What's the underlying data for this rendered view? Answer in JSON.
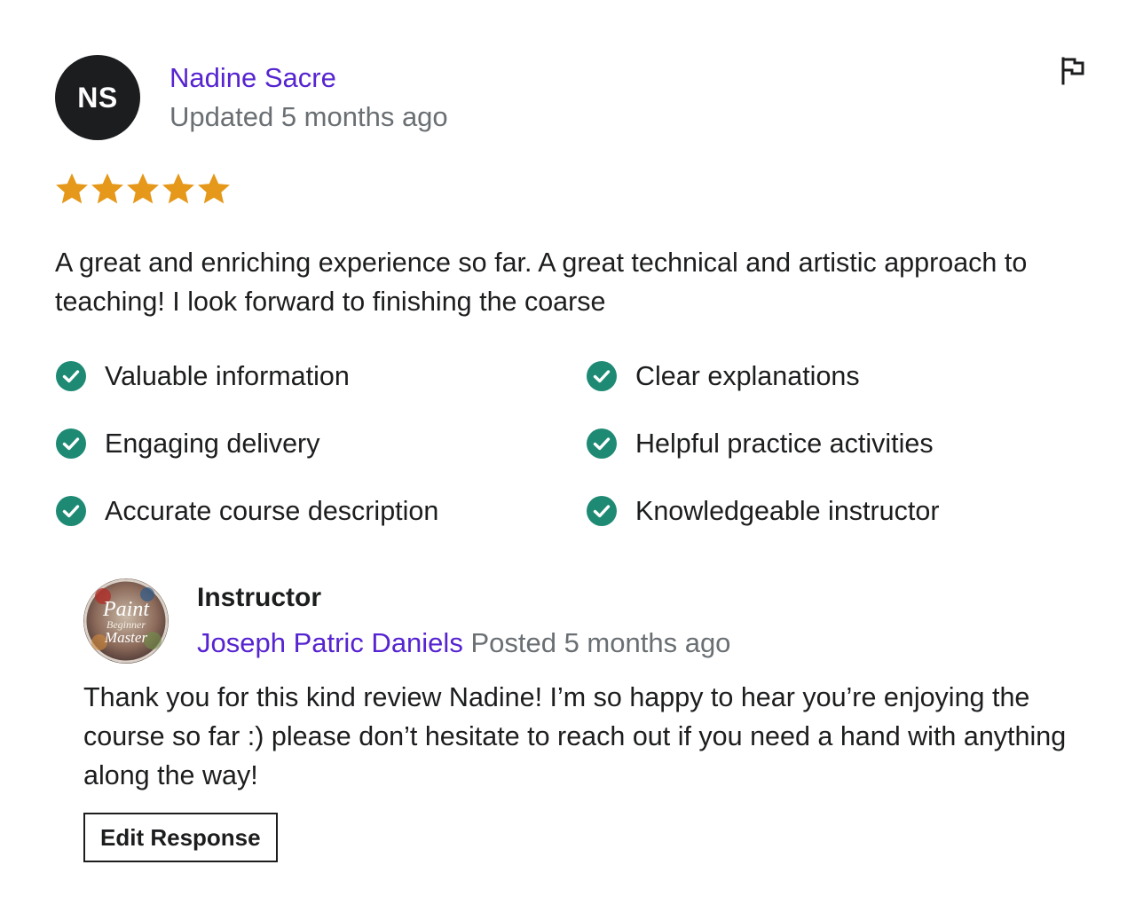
{
  "review": {
    "avatar_initials": "NS",
    "reviewer_name": "Nadine Sacre",
    "updated_text": "Updated 5 months ago",
    "rating": 5,
    "rating_max": 5,
    "star_color": "#e59819",
    "text": "A great and enriching experience so far. A great technical and artistic approach to teaching! I look forward to finishing the coarse",
    "flag_icon": "flag-icon",
    "feedback": [
      "Valuable information",
      "Clear explanations",
      "Engaging delivery",
      "Helpful practice activities",
      "Accurate course description",
      "Knowledgeable instructor"
    ],
    "check_color": "#1e8a74"
  },
  "response": {
    "role": "Instructor",
    "instructor_name": "Joseph Patric Daniels",
    "posted_text": "Posted 5 months ago",
    "avatar_text": [
      "Paint",
      "Beginner",
      "Master"
    ],
    "text": "Thank you for this kind review Nadine! I’m so happy to hear you’re enjoying the course so far :) please don’t hesitate to reach out if you need a hand with anything along the way!",
    "edit_button_label": "Edit Response"
  },
  "colors": {
    "link": "#5624d0",
    "muted": "#6a6f73",
    "text": "#1c1d1f"
  }
}
